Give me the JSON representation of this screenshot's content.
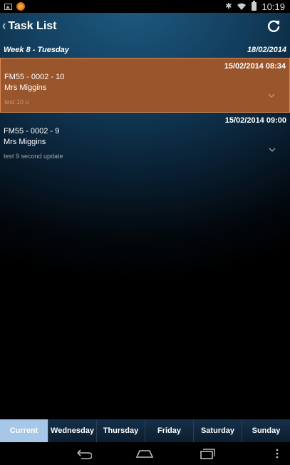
{
  "status_bar": {
    "time": "10:19"
  },
  "header": {
    "title": "Task List",
    "icons": [
      "chevron-left-icon",
      "refresh-icon"
    ]
  },
  "week": {
    "label": "Week 8 - Tuesday",
    "date": "18/02/2014"
  },
  "tasks": [
    {
      "datetime": "15/02/2014 08:34",
      "code": "FM55 - 0002 - 10",
      "person": "Mrs Miggins",
      "note": "test 10 u",
      "selected": true
    },
    {
      "datetime": "15/02/2014 09:00",
      "code": "FM55 - 0002 - 9",
      "person": "Mrs Miggins",
      "note": "test 9 second update",
      "selected": false
    }
  ],
  "tabs": [
    "Current",
    "Wednesday",
    "Thursday",
    "Friday",
    "Saturday",
    "Sunday"
  ],
  "active_tab": "Current",
  "colors": {
    "selected_task": "#99552b",
    "active_tab": "#a7c7e8"
  }
}
